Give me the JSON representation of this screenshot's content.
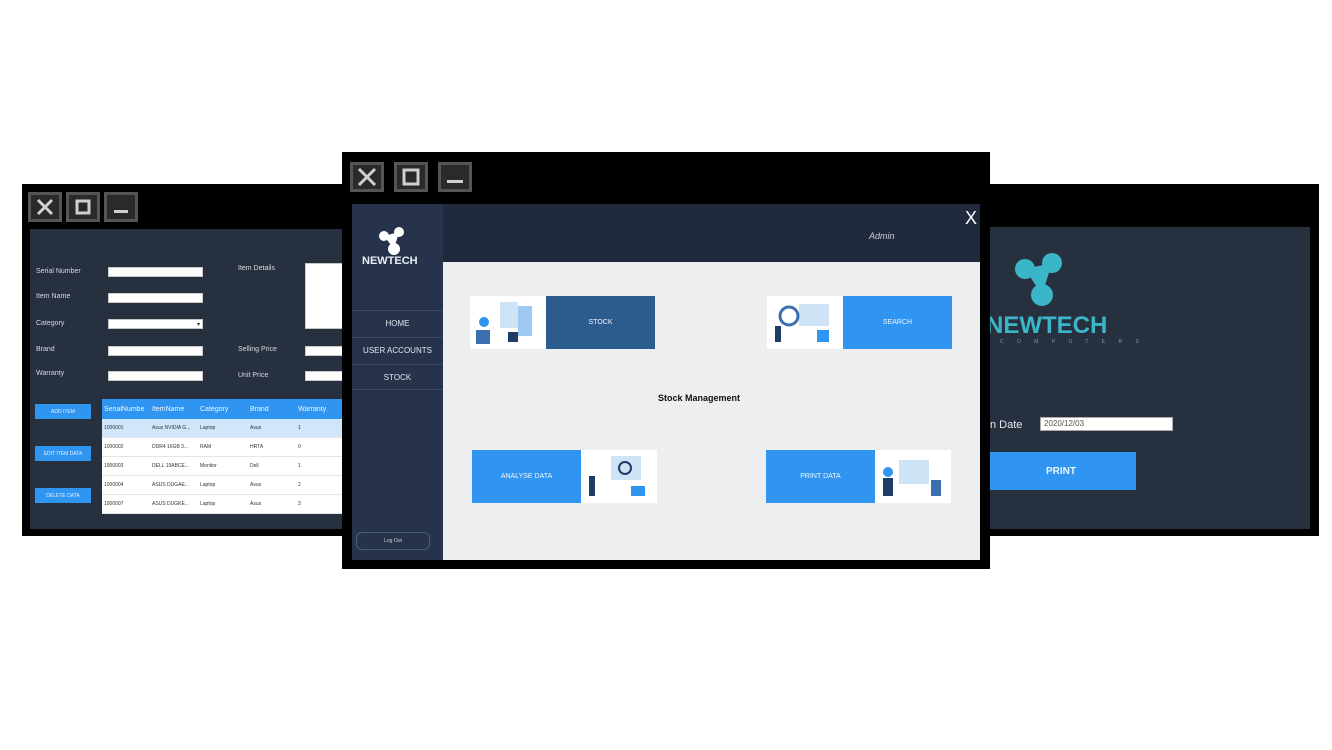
{
  "left_window": {
    "fields": {
      "serial_number": "Serial Number",
      "item_name": "Item Name",
      "category": "Category",
      "brand": "Brand",
      "warranty": "Warranty",
      "item_details": "Item Details",
      "selling_price": "Selling Price",
      "unit_price": "Unit Price"
    },
    "buttons": [
      "ADD ITEM",
      "EDIT ITEM DATA",
      "DELETE DATA"
    ],
    "table": {
      "columns": [
        "SerialNumbe",
        "ItemName",
        "Category",
        "Brand",
        "Warranty"
      ],
      "rows": [
        [
          "1000001",
          "Asus NVIDIA G...",
          "Laptop",
          "Asus",
          "1"
        ],
        [
          "1000002",
          "DDR4 16GB 3...",
          "RAM",
          "HRTA",
          "0"
        ],
        [
          "1000003",
          "DELL 19ABCE...",
          "Monitor",
          "Dell",
          "1"
        ],
        [
          "1000004",
          "ASUS DUGAE...",
          "Laptop",
          "Asus",
          "2"
        ],
        [
          "1000007",
          "ASUS DUGKE...",
          "Laptop",
          "Asus",
          "3"
        ]
      ]
    }
  },
  "center_window": {
    "brand": "NEWTECH",
    "user": "Admin",
    "close": "X",
    "nav": [
      "HOME",
      "USER ACCOUNTS",
      "STOCK"
    ],
    "logout": "Log Out",
    "title": "Stock Management",
    "tiles": {
      "stock": "STOCK",
      "search": "SEARCH",
      "analyse": "ANALYSE DATA",
      "print": "PRINT DATA"
    }
  },
  "right_window": {
    "brand": "NEWTECH",
    "brand_sub": "C O M P U T E R S",
    "date_label": "n Date",
    "date_value": "2020/12/03",
    "print_button": "PRINT"
  },
  "colors": {
    "dark_bg": "#27303f",
    "accent_blue": "#2f95f0",
    "dark_blue_button": "#2c5b8e",
    "logo_teal": "#3bb6c8"
  }
}
